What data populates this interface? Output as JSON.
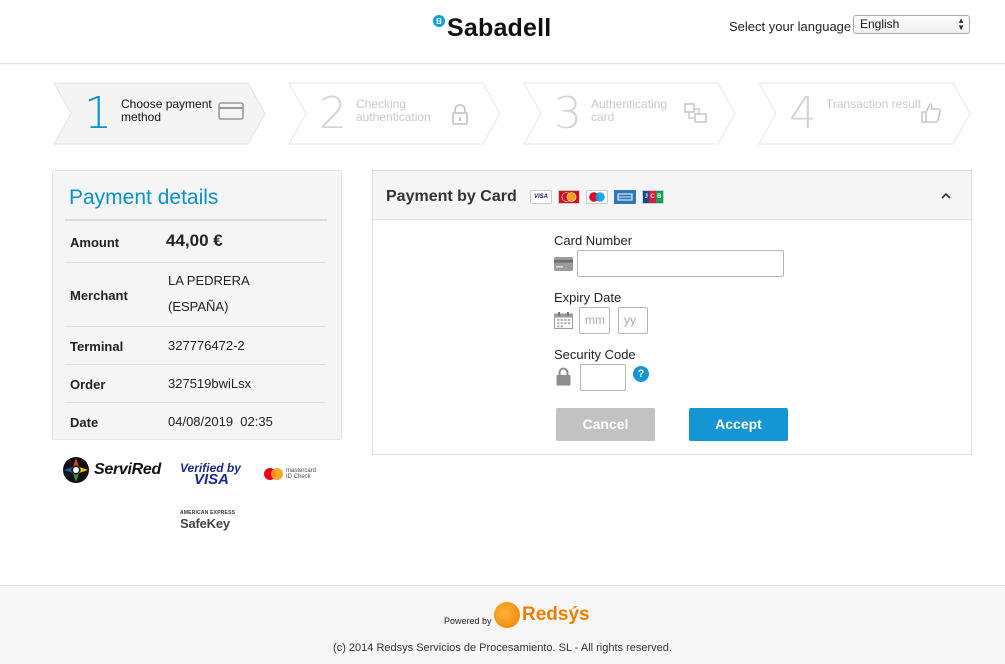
{
  "header": {
    "logo_badge": "B",
    "logo_text": "Sabadell",
    "language_label": "Select your language",
    "language_value": "English"
  },
  "steps": [
    {
      "number": "1",
      "label": "Choose payment method",
      "icon": "credit-card-icon",
      "state": "active"
    },
    {
      "number": "2",
      "label": "Checking authentication",
      "icon": "lock-icon",
      "state": "inactive"
    },
    {
      "number": "3",
      "label": "Authenticating card",
      "icon": "devices-icon",
      "state": "inactive"
    },
    {
      "number": "4",
      "label": "Transaction result",
      "icon": "thumbs-up-icon",
      "state": "inactive"
    }
  ],
  "details": {
    "title": "Payment details",
    "amount_label": "Amount",
    "amount_value": "44,00 €",
    "merchant_label": "Merchant",
    "merchant_line1": "LA PEDRERA",
    "merchant_line2": "(ESPAÑA)",
    "terminal_label": "Terminal",
    "terminal_value": "327776472-2",
    "order_label": "Order",
    "order_value": "327519bwiLsx",
    "date_label": "Date",
    "date_value": "04/08/2019  02:35"
  },
  "brands": {
    "servired": "ServiRed",
    "vbv_line1": "Verified by",
    "vbv_line2": "VISA",
    "mc_line1": "mastercard",
    "mc_line2": "ID Check",
    "amex_line1": "AMERICAN EXPRESS",
    "amex_line2": "SafeKey"
  },
  "card": {
    "title": "Payment by Card",
    "card_logos": [
      "VISA",
      "mastercard",
      "maestro",
      "AMEX",
      "JCB"
    ],
    "card_number_label": "Card Number",
    "card_number_value": "",
    "expiry_label": "Expiry Date",
    "expiry_month_placeholder": "mm",
    "expiry_year_placeholder": "yy",
    "security_label": "Security Code",
    "security_value": "",
    "help_glyph": "?",
    "cancel_label": "Cancel",
    "accept_label": "Accept",
    "collapse_glyph": "^"
  },
  "footer": {
    "powered_by": "Powered by",
    "redsys": "Redsýs",
    "copyright": "(c) 2014 Redsys Servicios de Procesamiento. SL - All rights reserved."
  },
  "colors": {
    "accent": "#1595d3",
    "step_active": "#0a92c8",
    "cancel_bg": "#c2c2c2",
    "redsys_orange": "#f07d00"
  }
}
